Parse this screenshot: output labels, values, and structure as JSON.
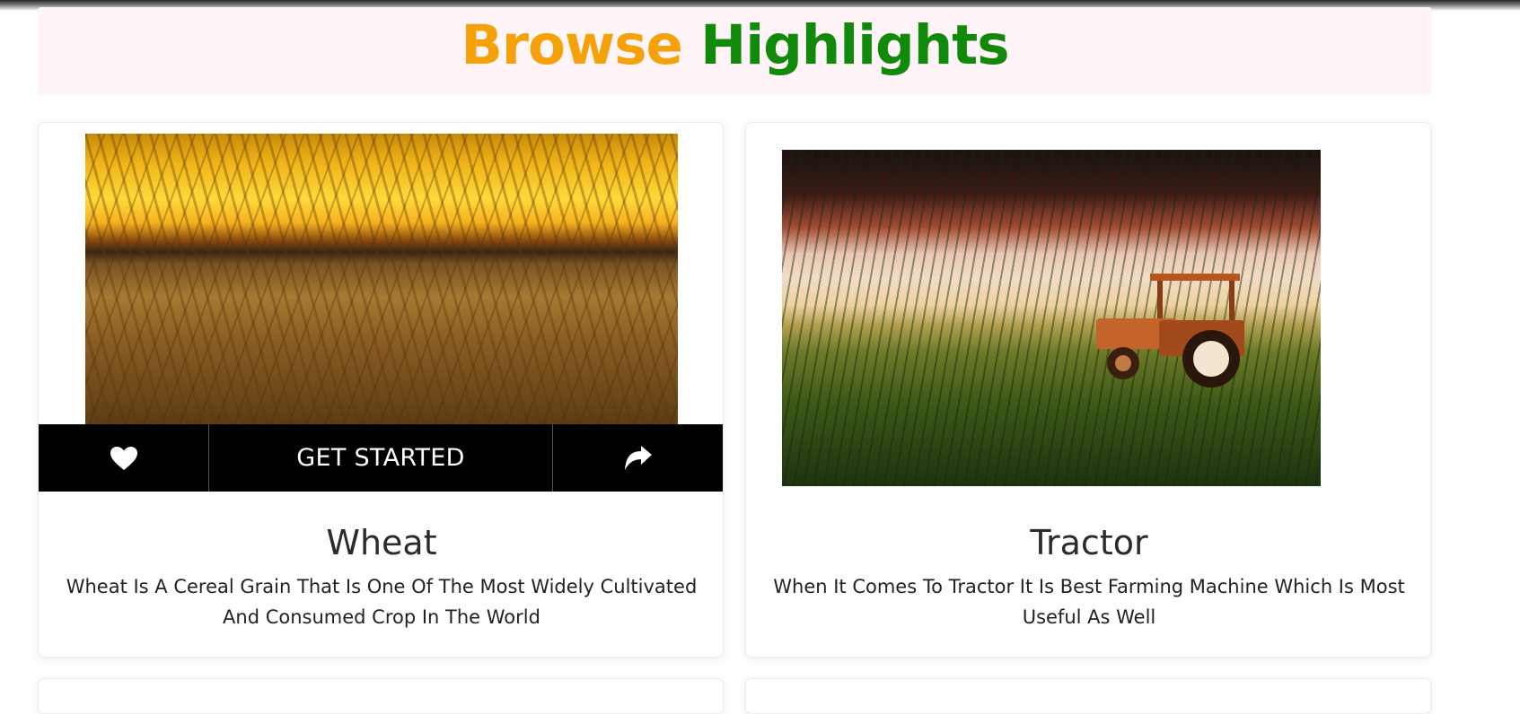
{
  "heading": {
    "word1": "Browse",
    "word2": "Highlights"
  },
  "colors": {
    "accent_orange": "#f5a20a",
    "accent_green": "#118a0c",
    "band": "#fff4f8"
  },
  "cards": [
    {
      "title": "Wheat",
      "description": "Wheat Is A Cereal Grain That Is One Of The Most Widely Cultivated And Consumed Crop In The World",
      "image": "wheat-field-sunset",
      "actions": {
        "like_icon": "heart-icon",
        "cta_label": "GET STARTED",
        "share_icon": "share-icon"
      }
    },
    {
      "title": "Tractor",
      "description": "When It Comes To Tractor It Is Best Farming Machine Which Is Most Useful As Well",
      "image": "tractor-in-field"
    }
  ]
}
